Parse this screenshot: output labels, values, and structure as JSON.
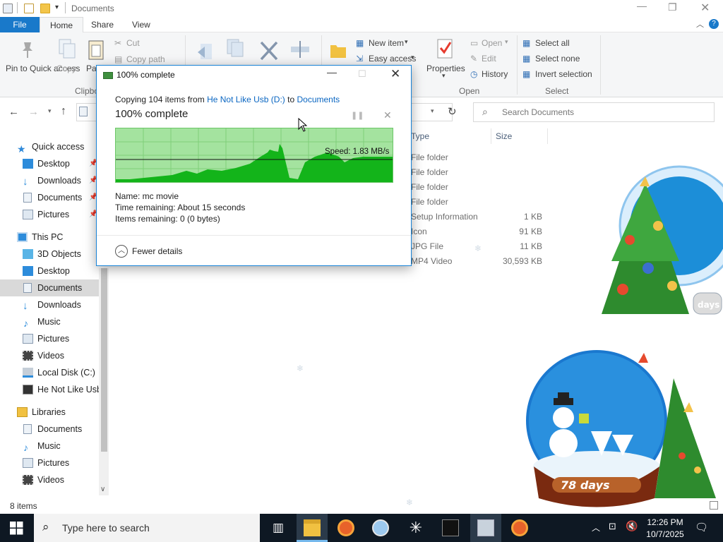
{
  "window": {
    "title": "Documents"
  },
  "menu": {
    "file": "File",
    "home": "Home",
    "share": "Share",
    "view": "View"
  },
  "ribbon": {
    "pin": "Pin to Quick access",
    "copy": "Copy",
    "paste": "Pa",
    "cut": "Cut",
    "copy_path": "Copy path",
    "clipboard_group": "Clipbo",
    "new_item": "New item",
    "easy_access": "Easy access",
    "properties": "Properties",
    "open": "Open",
    "edit": "Edit",
    "history": "History",
    "open_group": "Open",
    "select_all": "Select all",
    "select_none": "Select none",
    "invert_selection": "Invert selection",
    "select_group": "Select"
  },
  "search": {
    "placeholder": "Search Documents"
  },
  "sidebar": {
    "quick_access": "Quick access",
    "qa_items": [
      "Desktop",
      "Downloads",
      "Documents",
      "Pictures"
    ],
    "this_pc": "This PC",
    "pc_items": [
      "3D Objects",
      "Desktop",
      "Documents",
      "Downloads",
      "Music",
      "Pictures",
      "Videos",
      "Local Disk (C:)",
      "He Not Like Usb"
    ],
    "libraries": "Libraries",
    "lib_items": [
      "Documents",
      "Music",
      "Pictures",
      "Videos"
    ]
  },
  "columns": {
    "type": "Type",
    "size": "Size"
  },
  "files": [
    {
      "type": "File folder",
      "size": ""
    },
    {
      "type": "File folder",
      "size": ""
    },
    {
      "type": "File folder",
      "size": ""
    },
    {
      "type": "File folder",
      "size": ""
    },
    {
      "type": "Setup Information",
      "size": "1 KB"
    },
    {
      "type": "Icon",
      "size": "91 KB"
    },
    {
      "type": "JPG File",
      "size": "11 KB"
    },
    {
      "type": "MP4 Video",
      "size": "30,593 KB"
    }
  ],
  "status": {
    "items": "8 items"
  },
  "dialog": {
    "title": "100% complete",
    "copying_prefix": "Copying 104 items from",
    "source": "He Not Like Usb (D:)",
    "to": "to",
    "dest": "Documents",
    "heading": "100% complete",
    "speed": "Speed: 1.83 MB/s",
    "speed_fraction": 0.28,
    "progress_fraction": 1.0,
    "name": "Name:  mc movie",
    "time_remaining": "Time remaining:  About 15 seconds",
    "items_remaining": "Items remaining:  0 (0 bytes)",
    "fewer_details": "Fewer details"
  },
  "decor": {
    "countdown": "78 days",
    "tree_badge": "days"
  },
  "taskbar": {
    "search_placeholder": "Type here to search",
    "time": "12:26 PM",
    "date": "10/7/2025"
  },
  "colors": {
    "accent": "#1979ca",
    "graph_fill": "#13b41a",
    "graph_bg": "#a4e39f",
    "taskbar": "#0e1823"
  }
}
